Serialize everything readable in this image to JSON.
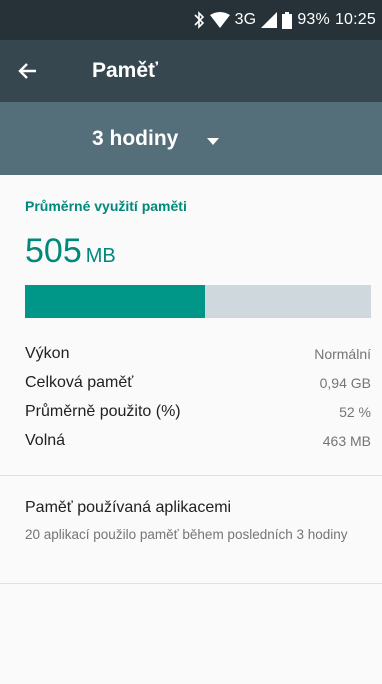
{
  "status_bar": {
    "network": "3G",
    "battery": "93%",
    "time": "10:25"
  },
  "app_bar": {
    "back_icon": "arrow-back-icon",
    "title": "Paměť"
  },
  "time_selector": {
    "selected": "3 hodiny",
    "icon": "dropdown-arrow-icon"
  },
  "memory": {
    "section_title": "Průměrné využití paměti",
    "value": "505",
    "unit": "MB",
    "used_fraction": 0.52,
    "colors": {
      "accent": "#00897b",
      "bar_fill": "#009688",
      "bar_track": "#cfd8dc"
    }
  },
  "stats": [
    {
      "label": "Výkon",
      "value": "Normální"
    },
    {
      "label": "Celková paměť",
      "value": "0,94 GB"
    },
    {
      "label": "Průměrně použito (%)",
      "value": "52 %"
    },
    {
      "label": "Volná",
      "value": "463 MB"
    }
  ],
  "apps": {
    "title": "Paměť používaná aplikacemi",
    "subtitle": "20 aplikací použilo paměť během posledních 3 hodiny"
  }
}
